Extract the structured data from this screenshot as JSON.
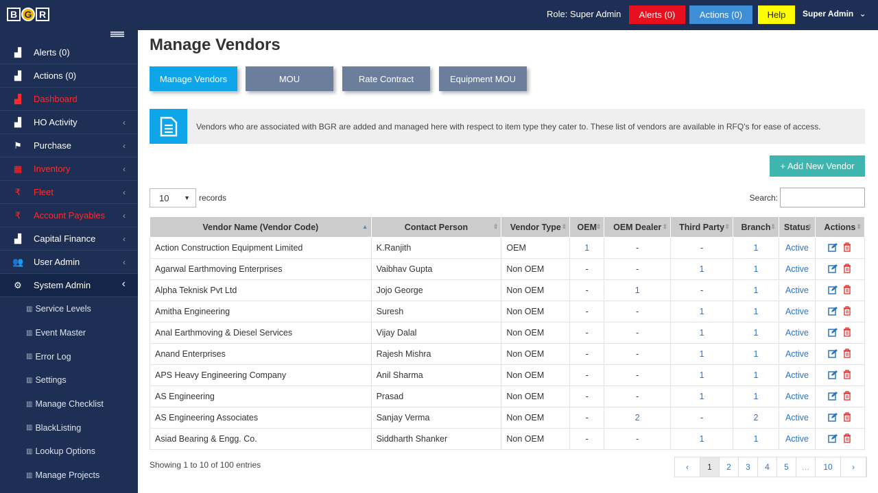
{
  "header": {
    "logo_letters": [
      "B",
      "G",
      "R"
    ],
    "role_text": "Role: Super Admin",
    "alerts_btn": "Alerts (0)",
    "actions_btn": "Actions (0)",
    "help_btn": "Help",
    "user_name": "Super Admin",
    "colors": {
      "alerts": "#e8101c",
      "actions": "#3d8ed6",
      "help": "#ffff00"
    }
  },
  "sidebar": {
    "items": [
      {
        "label": "Alerts (0)",
        "icon": "chart-area-icon",
        "red": false,
        "chevron": false
      },
      {
        "label": "Actions (0)",
        "icon": "chart-area-icon",
        "red": false,
        "chevron": false
      },
      {
        "label": "Dashboard",
        "icon": "chart-area-icon",
        "red": true,
        "chevron": false
      },
      {
        "label": "HO Activity",
        "icon": "chart-area-icon",
        "red": false,
        "chevron": true
      },
      {
        "label": "Purchase",
        "icon": "flag-icon",
        "red": false,
        "chevron": true
      },
      {
        "label": "Inventory",
        "icon": "inventory-icon",
        "red": true,
        "chevron": true
      },
      {
        "label": "Fleet",
        "icon": "rupee-icon",
        "red": true,
        "chevron": true
      },
      {
        "label": "Account Payables",
        "icon": "rupee-icon",
        "red": true,
        "chevron": true
      },
      {
        "label": "Capital Finance",
        "icon": "chart-area-icon",
        "red": false,
        "chevron": true
      },
      {
        "label": "User Admin",
        "icon": "users-icon",
        "red": false,
        "chevron": true
      },
      {
        "label": "System Admin",
        "icon": "gears-icon",
        "red": false,
        "chevron": true
      }
    ],
    "subitems": [
      "Service Levels",
      "Event Master",
      "Error Log",
      "Settings",
      "Manage Checklist",
      "BlackListing",
      "Lookup Options",
      "Manage Projects"
    ]
  },
  "main": {
    "title": "Manage Vendors",
    "tabs": [
      "Manage Vendors",
      "MOU",
      "Rate Contract",
      "Equipment MOU"
    ],
    "info_text": "Vendors who are associated with BGR are added and managed here with respect to item type they cater to. These list of vendors are available in RFQ's for ease of access.",
    "add_button": "+ Add New Vendor",
    "length_value": "10",
    "length_label": "records",
    "search_label": "Search:",
    "columns": [
      "Vendor Name (Vendor Code)",
      "Contact Person",
      "Vendor Type",
      "OEM",
      "OEM Dealer",
      "Third Party",
      "Branch",
      "Status",
      "Actions"
    ],
    "rows": [
      [
        "Action Construction Equipment Limited",
        "K.Ranjith",
        "OEM",
        "1",
        "-",
        "-",
        "1",
        "Active"
      ],
      [
        "Agarwal Earthmoving Enterprises",
        "Vaibhav Gupta",
        "Non OEM",
        "-",
        "-",
        "1",
        "1",
        "Active"
      ],
      [
        "Alpha Teknisk Pvt Ltd",
        "Jojo George",
        "Non OEM",
        "-",
        "1",
        "-",
        "1",
        "Active"
      ],
      [
        "Amitha Engineering",
        "Suresh",
        "Non OEM",
        "-",
        "-",
        "1",
        "1",
        "Active"
      ],
      [
        "Anal Earthmoving & Diesel Services",
        "Vijay Dalal",
        "Non OEM",
        "-",
        "-",
        "1",
        "1",
        "Active"
      ],
      [
        "Anand Enterprises",
        "Rajesh Mishra",
        "Non OEM",
        "-",
        "-",
        "1",
        "1",
        "Active"
      ],
      [
        "APS Heavy Engineering Company",
        "Anil Sharma",
        "Non OEM",
        "-",
        "-",
        "1",
        "1",
        "Active"
      ],
      [
        "AS Engineering",
        "Prasad",
        "Non OEM",
        "-",
        "-",
        "1",
        "1",
        "Active"
      ],
      [
        "AS Engineering Associates",
        "Sanjay Verma",
        "Non OEM",
        "-",
        "2",
        "-",
        "2",
        "Active"
      ],
      [
        "Asiad Bearing & Engg. Co.",
        "Siddharth Shanker",
        "Non OEM",
        "-",
        "-",
        "1",
        "1",
        "Active"
      ]
    ],
    "showing_text": "Showing 1 to 10 of 100 entries",
    "pages": [
      "‹",
      "1",
      "2",
      "3",
      "4",
      "5",
      "…",
      "10",
      "›"
    ],
    "current_page": "1"
  }
}
